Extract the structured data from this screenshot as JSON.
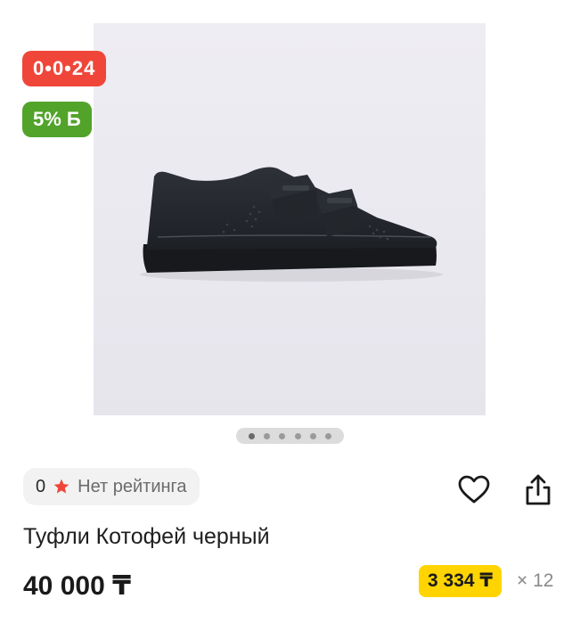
{
  "badges": {
    "timer": "0•0•24",
    "discount": "5% Б"
  },
  "gallery": {
    "image": "black-velcro-sneaker",
    "pages": 6,
    "active_page": 1
  },
  "rating": {
    "count": "0",
    "label": "Нет рейтинга",
    "star_color": "#f0463a"
  },
  "actions": {
    "favorite_icon": "heart-icon",
    "share_icon": "share-icon"
  },
  "product": {
    "title": "Туфли Котофей черный",
    "price": "40 000 ₸"
  },
  "installment": {
    "amount": "3 334 ₸",
    "multiplier": "× 12",
    "color": "#ffd400"
  }
}
